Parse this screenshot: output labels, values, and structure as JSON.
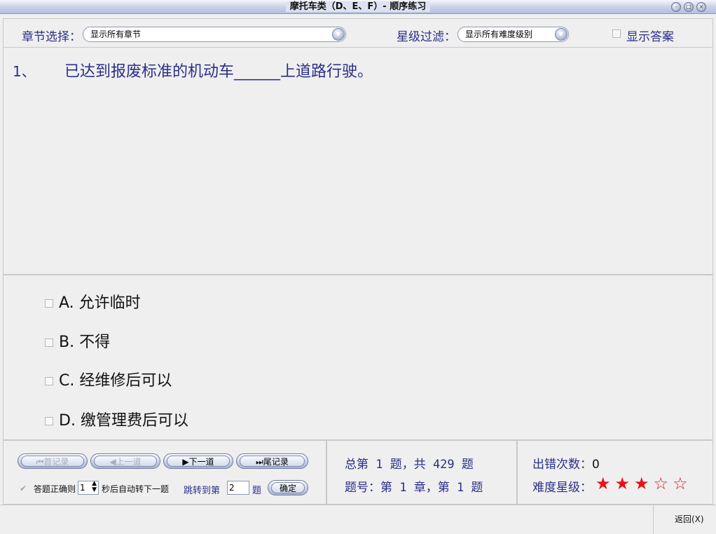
{
  "window": {
    "title": "摩托车类（D、E、F）- 顺序练习"
  },
  "toolbar": {
    "chapter_label": "章节选择：",
    "chapter_value": "显示所有章节",
    "star_label": "星级过滤：",
    "star_value": "显示所有难度级别",
    "show_answer": "显示答案"
  },
  "question": {
    "number": "1、",
    "text": "已达到报废标准的机动车______上道路行驶。"
  },
  "options": [
    {
      "key": "A.",
      "text": "允许临时"
    },
    {
      "key": "B.",
      "text": "不得"
    },
    {
      "key": "C.",
      "text": "经维修后可以"
    },
    {
      "key": "D.",
      "text": "缴管理费后可以"
    }
  ],
  "nav": {
    "first": "首记录",
    "prev": "上一道",
    "next": "下一道",
    "last": "尾记录",
    "auto_label_1": "答题正确则",
    "auto_seconds": "1",
    "auto_label_2": "秒后自动转下一题",
    "jump_label_1": "跳转到第",
    "jump_value": "2",
    "jump_label_2": "题",
    "confirm": "确定"
  },
  "progress": {
    "total_line": "总第 1 题，共 429 题",
    "chapter_line": "题号：第 1 章，第 1 题"
  },
  "stats": {
    "error_label": "出错次数：",
    "error_count": "0",
    "difficulty_label": "难度星级：",
    "difficulty": 3,
    "difficulty_max": 5,
    "stars": "★★★☆☆"
  },
  "status": {
    "back": "返回(X)"
  },
  "colors": {
    "accent_text": "#2b2f88",
    "star": "#e8121a"
  }
}
